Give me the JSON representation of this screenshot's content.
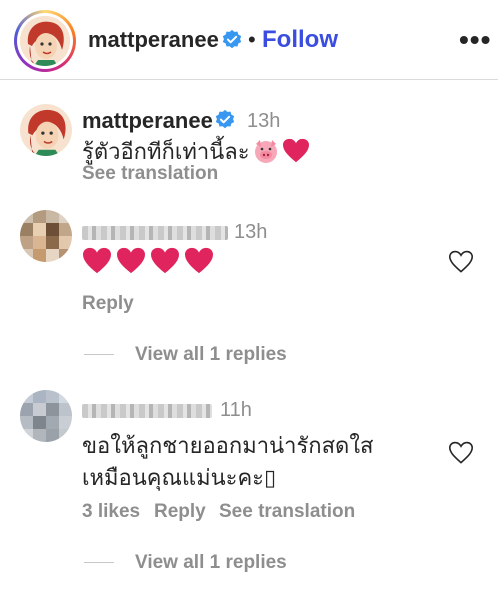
{
  "header": {
    "username": "mattperanee",
    "dot": "•",
    "follow_label": "Follow",
    "more_label": "•••"
  },
  "caption": {
    "username": "mattperanee",
    "time": "13h",
    "text": "รู้ตัวอีกทีก็เท่านี้ละ",
    "see_translation": "See translation"
  },
  "comments": [
    {
      "time": "13h",
      "text_emoji": [
        "red-heart",
        "red-heart",
        "red-heart",
        "red-heart"
      ],
      "reply_label": "Reply",
      "view_all": "View all 1 replies"
    },
    {
      "time": "11h",
      "line1": "ขอให้ลูกชายออกมาน่ารักสดใส",
      "line2": "เหมือนคุณแม่นะคะ▯",
      "likes": "3 likes",
      "reply_label": "Reply",
      "see_translation": "See translation",
      "view_all": "View all 1 replies"
    }
  ],
  "colors": {
    "follow": "#3b4de0",
    "verified": "#3897f0",
    "heart": "#e0245e",
    "meta": "#8e8e8e"
  }
}
